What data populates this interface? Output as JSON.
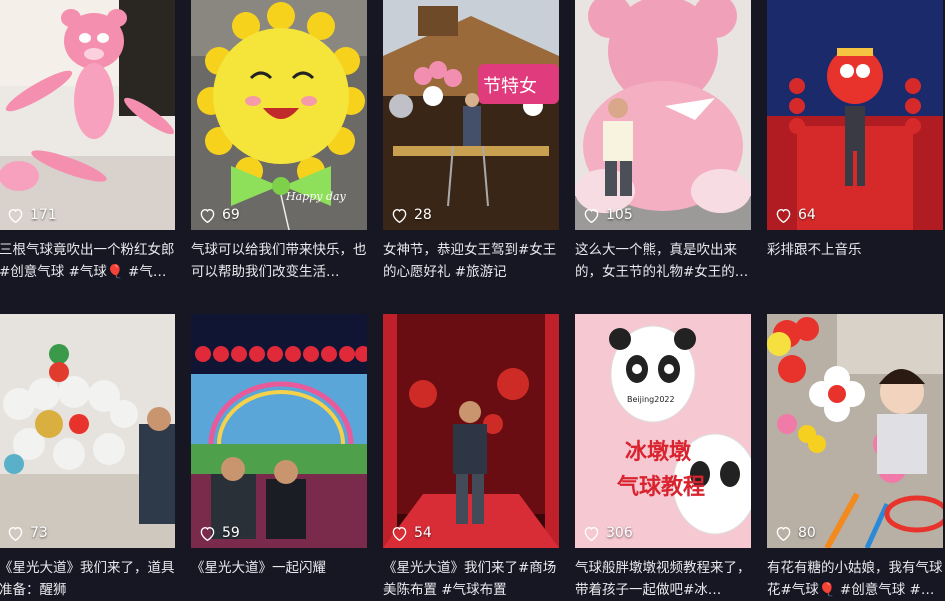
{
  "feed": {
    "cards": [
      {
        "likes": "171",
        "desc": "三根气球竟吹出一个粉红女郎#创意气球 #气球🎈 #气…",
        "thumb": "pink-panther-balloon"
      },
      {
        "likes": "69",
        "desc": "气球可以给我们带来快乐，也可以帮助我们改变生活…",
        "thumb": "sunflower-balloon"
      },
      {
        "likes": "28",
        "desc": "女神节，恭迎女王驾到#女王的心愿好礼 #旅游记",
        "thumb": "storefront-balloon-arch"
      },
      {
        "likes": "105",
        "desc": "这么大一个熊，真是吹出来的，女王节的礼物#女王的…",
        "thumb": "giant-pink-bear"
      },
      {
        "likes": "64",
        "desc": "彩排跟不上音乐",
        "thumb": "lion-dance-stage"
      },
      {
        "likes": "73",
        "desc": "《星光大道》我们来了，道具准备：醒狮",
        "thumb": "lion-head-balloon"
      },
      {
        "likes": "59",
        "desc": "《星光大道》一起闪耀",
        "thumb": "rainbow-stage"
      },
      {
        "likes": "54",
        "desc": "《星光大道》我们来了#商场美陈布置 #气球布置",
        "thumb": "red-stage"
      },
      {
        "likes": "306",
        "desc": "气球般胖墩墩视频教程来了，带着孩子一起做吧#冰…",
        "thumb": "bing-dwen-dwen"
      },
      {
        "likes": "80",
        "desc": "有花有糖的小姑娘，我有气球花#气球🎈 #创意气球 #…",
        "thumb": "balloon-flower-girl"
      }
    ],
    "thumb_text": {
      "sunflower": "Happy day",
      "banner": "节特女",
      "bing_big": "冰墩墩",
      "bing_sub": "气球教程",
      "bing_brand": "Beijing2022"
    }
  },
  "colors": {
    "background": "#161722",
    "text": "#e8e8ee",
    "likes": "#ffffff"
  }
}
